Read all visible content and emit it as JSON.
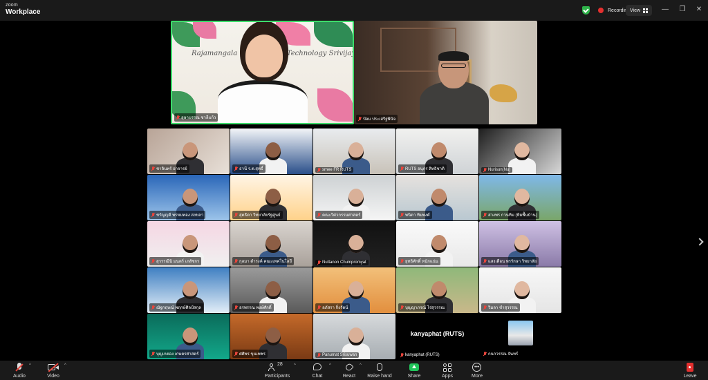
{
  "app": {
    "brand_small": "zoom",
    "brand_big": "Workplace"
  },
  "header": {
    "recording_label": "Recording",
    "view_label": "View",
    "controls": {
      "minimize": "—",
      "restore": "❐",
      "close": "✕"
    }
  },
  "speakers": [
    {
      "name": "อุษาบรรณ ชาลีแก้ว",
      "banner": "Rajamangala University of Technology Srivijaya"
    },
    {
      "name": "ป้อม ประเสริฐพินิจ"
    }
  ],
  "gallery": [
    {
      "name": "ชาลินทร์ อาจารย์"
    },
    {
      "name": "ธานี ร.ต.สุทธิ์"
    },
    {
      "name": "smee FR RUTS"
    },
    {
      "name": "RUTS อนุกร สิทธิชาติ"
    },
    {
      "name": "Nurisun(Nu)"
    },
    {
      "name": "ชรัญญดี พรหมทอง สงขลา"
    },
    {
      "name": "สุดธิดา วิทยาลัยรัฐศูนย์"
    },
    {
      "name": "คณะวิศวกรรมศาสตร์"
    },
    {
      "name": "พนิดา ทิมพงศ์"
    },
    {
      "name": "สวงพร กวนทิม (ทีมพื้นบ้าน)"
    },
    {
      "name": "สุวรรณีนิ มนตร์ เภสัชกร"
    },
    {
      "name": "กุลมา ดำรงค์ คณะเทคโนโลยี"
    },
    {
      "name": "Nuttanon Chumpromyat"
    },
    {
      "name": "ยุทธิศักดิ์ หนักแน่น"
    },
    {
      "name": "แสงเดือน พรรักษา วิทยาลัย"
    },
    {
      "name": "ณัฐกฤษณ์ พฤกษ์ศิลป์สกุล"
    },
    {
      "name": "อรพรรณ พงษ์ศักดิ์"
    },
    {
      "name": "ลภัสรา กิ่งรัตน์"
    },
    {
      "name": "บุญญาภรณ์ ไร่สุวรรณ"
    },
    {
      "name": "วิมลา ขำสุวรรณ"
    },
    {
      "name": "บุญเกตอง เกษตรศาสตร์"
    },
    {
      "name": "ศศิพร ขุนเพชร"
    },
    {
      "name": "Panumat Srisuwan"
    },
    {
      "name": "kanyaphat (RUTS)",
      "big": "kanyaphat (RUTS)"
    },
    {
      "name": "กนกวรรณ จันทร์"
    }
  ],
  "toolbar": {
    "audio": "Audio",
    "video": "Video",
    "participants": "Participants",
    "participants_count": "28",
    "chat": "Chat",
    "react": "React",
    "raise_hand": "Raise hand",
    "share": "Share",
    "apps": "Apps",
    "more": "More",
    "leave": "Leave"
  },
  "colors": {
    "speaker_border": "#3ddc6b",
    "share_green": "#21c45a",
    "mute_red": "#e8453c",
    "leave_red": "#e5302f"
  }
}
